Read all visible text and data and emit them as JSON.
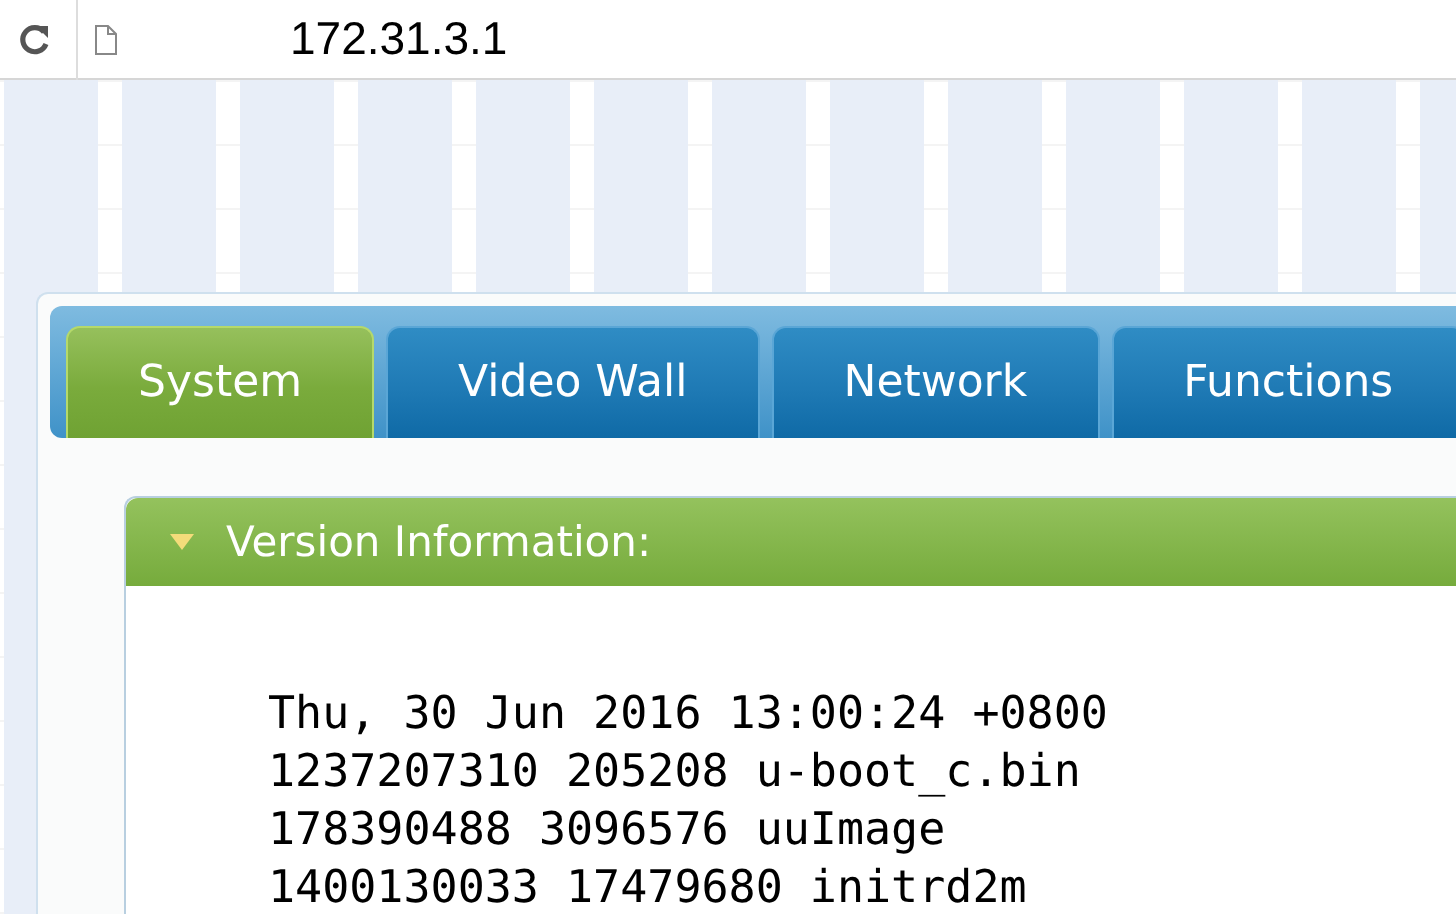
{
  "browser": {
    "url": "172.31.3.1"
  },
  "tabs": [
    {
      "label": "System",
      "selected": true
    },
    {
      "label": "Video Wall",
      "selected": false
    },
    {
      "label": "Network",
      "selected": false
    },
    {
      "label": "Functions",
      "selected": false
    }
  ],
  "section": {
    "title": "Version Information:",
    "expanded": true,
    "lines": [
      "Thu, 30 Jun 2016 13:00:24 +0800",
      "1237207310 205208 u-boot_c.bin",
      "178390488 3096576 uuImage",
      "1400130033 17479680 initrd2m"
    ]
  }
}
